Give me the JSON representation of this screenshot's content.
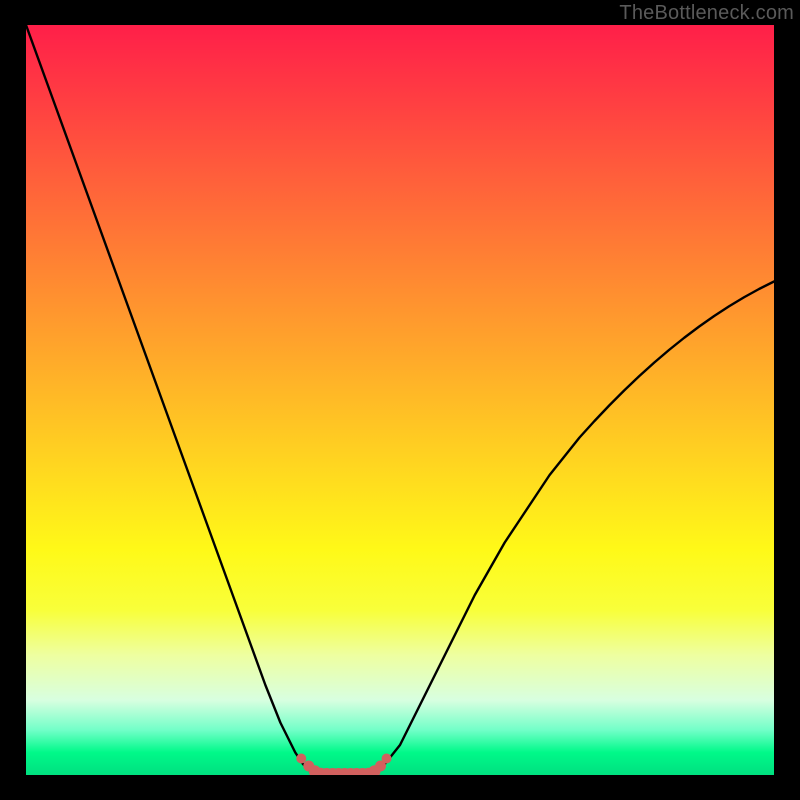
{
  "watermark": "TheBottleneck.com",
  "colors": {
    "page_bg": "#000000",
    "curve_stroke": "#000000",
    "marker_fill": "#d1605e",
    "gradient_top": "#ff1f49",
    "gradient_bottom": "#00e080"
  },
  "chart_data": {
    "type": "line",
    "title": "",
    "xlabel": "",
    "ylabel": "",
    "xlim": [
      0,
      100
    ],
    "ylim": [
      0,
      100
    ],
    "x": [
      0,
      2,
      4,
      6,
      8,
      10,
      12,
      14,
      16,
      18,
      20,
      22,
      24,
      26,
      28,
      30,
      32,
      34,
      36,
      37,
      38,
      39,
      40,
      41,
      42,
      43,
      44,
      45,
      46,
      47,
      48,
      50,
      52,
      54,
      56,
      58,
      60,
      62,
      64,
      66,
      68,
      70,
      72,
      74,
      76,
      78,
      80,
      82,
      84,
      86,
      88,
      90,
      92,
      94,
      96,
      98,
      100
    ],
    "y": [
      100,
      94.5,
      89,
      83.5,
      78,
      72.5,
      67,
      61.5,
      56,
      50.5,
      45,
      39.5,
      34,
      28.5,
      23,
      17.5,
      12,
      7,
      3,
      1.5,
      0.5,
      0,
      0,
      0,
      0,
      0,
      0,
      0,
      0,
      0.5,
      1.5,
      4,
      8,
      12,
      16,
      20,
      24,
      27.5,
      31,
      34,
      37,
      40,
      42.5,
      45,
      47.2,
      49.3,
      51.3,
      53.2,
      55,
      56.7,
      58.3,
      59.8,
      61.2,
      62.5,
      63.7,
      64.8,
      65.8
    ],
    "series_name": "bottleneck_curve",
    "markers": {
      "x": [
        36.8,
        37.8,
        38.6,
        39.4,
        40.2,
        41,
        41.8,
        42.6,
        43.4,
        44.2,
        45,
        45.8,
        46.6,
        47.4,
        48.2
      ],
      "y": [
        2.2,
        1.2,
        0.5,
        0.1,
        0,
        0,
        0,
        0,
        0,
        0,
        0,
        0.1,
        0.5,
        1.2,
        2.2
      ],
      "r": [
        5,
        5.5,
        6,
        6.5,
        7,
        7,
        7,
        7,
        7,
        7,
        7,
        6.5,
        6,
        5.5,
        5
      ]
    }
  }
}
